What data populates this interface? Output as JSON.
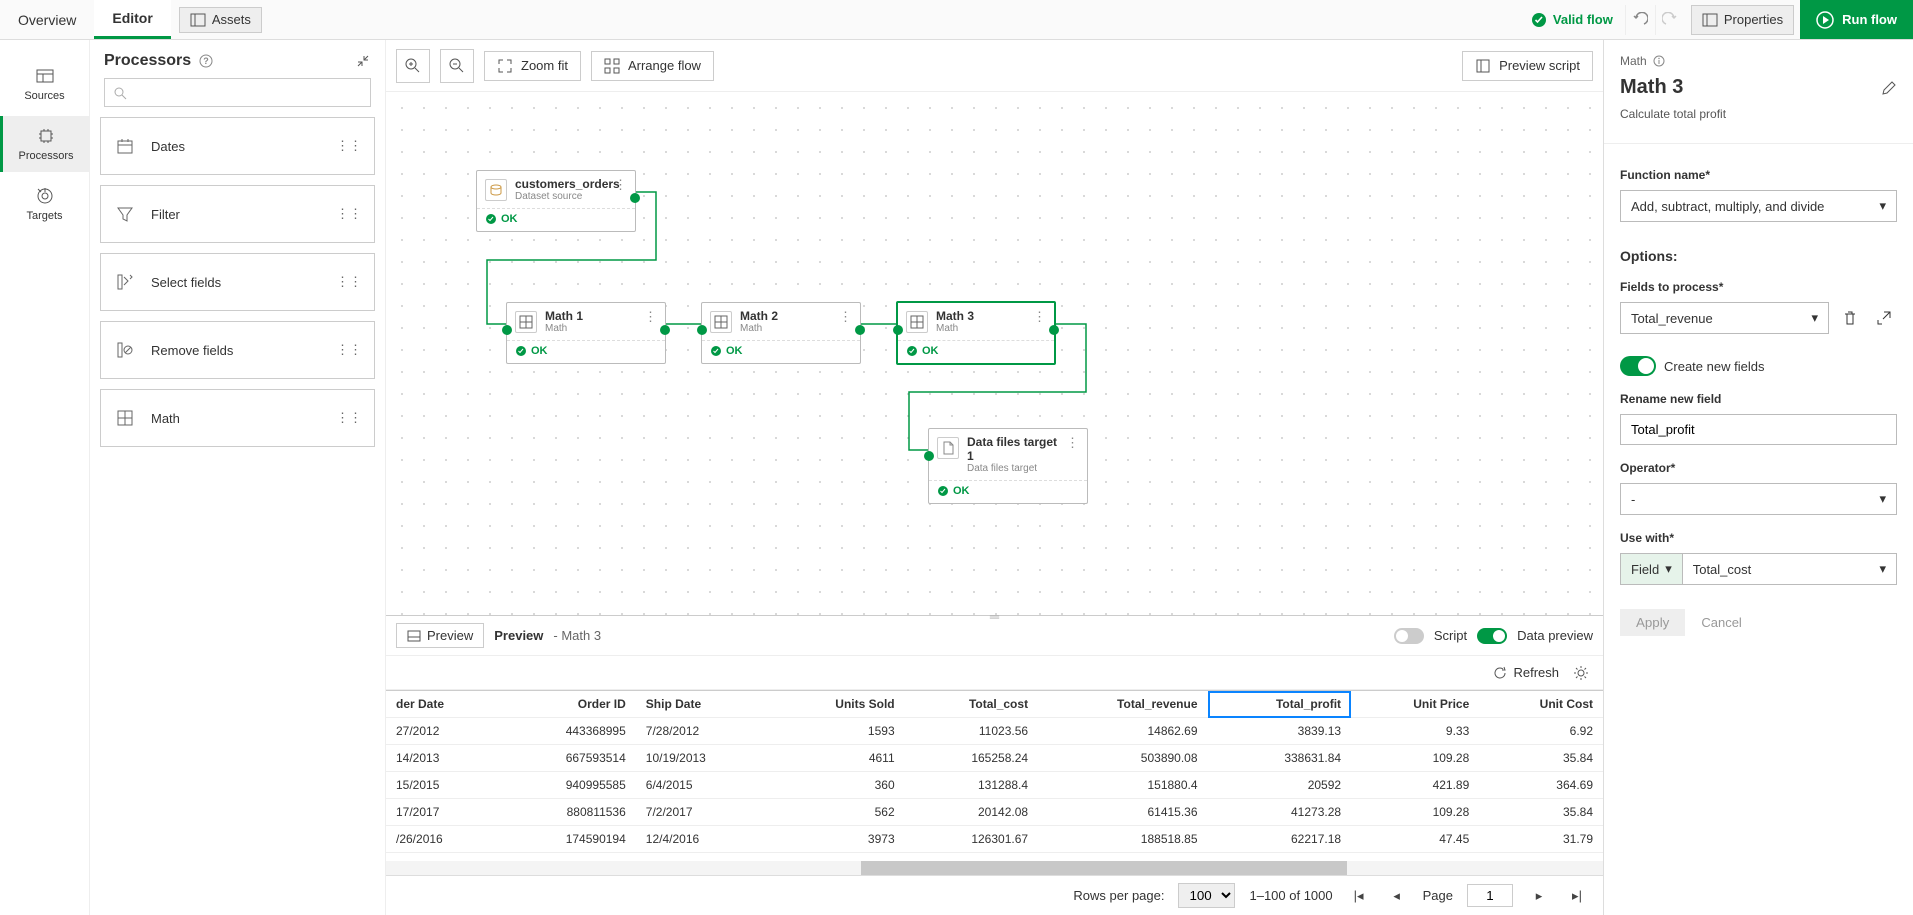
{
  "topbar": {
    "tab_overview": "Overview",
    "tab_editor": "Editor",
    "assets": "Assets",
    "valid_flow": "Valid flow",
    "properties": "Properties",
    "run_flow": "Run flow"
  },
  "leftnav": {
    "sources": "Sources",
    "processors": "Processors",
    "targets": "Targets"
  },
  "procpanel": {
    "title": "Processors",
    "items": [
      {
        "label": "Dates"
      },
      {
        "label": "Filter"
      },
      {
        "label": "Select fields"
      },
      {
        "label": "Remove fields"
      },
      {
        "label": "Math"
      }
    ]
  },
  "canvas_toolbar": {
    "zoom_fit": "Zoom fit",
    "arrange_flow": "Arrange flow",
    "preview_script": "Preview script"
  },
  "nodes": {
    "n1": {
      "title": "customers_orders",
      "sub": "Dataset source",
      "status": "OK"
    },
    "n2": {
      "title": "Math 1",
      "sub": "Math",
      "status": "OK"
    },
    "n3": {
      "title": "Math 2",
      "sub": "Math",
      "status": "OK"
    },
    "n4": {
      "title": "Math 3",
      "sub": "Math",
      "status": "OK"
    },
    "n5": {
      "title": "Data files target 1",
      "sub": "Data files target",
      "status": "OK"
    }
  },
  "preview": {
    "btn": "Preview",
    "label": "Preview",
    "context": "- Math 3",
    "script": "Script",
    "data_preview": "Data preview",
    "refresh": "Refresh",
    "columns": [
      "der Date",
      "Order ID",
      "Ship Date",
      "Units Sold",
      "Total_cost",
      "Total_revenue",
      "Total_profit",
      "Unit Price",
      "Unit Cost"
    ],
    "highlight_col": "Total_profit",
    "rows": [
      [
        "27/2012",
        "443368995",
        "7/28/2012",
        "1593",
        "11023.56",
        "14862.69",
        "3839.13",
        "9.33",
        "6.92"
      ],
      [
        "14/2013",
        "667593514",
        "10/19/2013",
        "4611",
        "165258.24",
        "503890.08",
        "338631.84",
        "109.28",
        "35.84"
      ],
      [
        "15/2015",
        "940995585",
        "6/4/2015",
        "360",
        "131288.4",
        "151880.4",
        "20592",
        "421.89",
        "364.69"
      ],
      [
        "17/2017",
        "880811536",
        "7/2/2017",
        "562",
        "20142.08",
        "61415.36",
        "41273.28",
        "109.28",
        "35.84"
      ],
      [
        "/26/2016",
        "174590194",
        "12/4/2016",
        "3973",
        "126301.67",
        "188518.85",
        "62217.18",
        "47.45",
        "31.79"
      ]
    ],
    "rows_per_page_label": "Rows per page:",
    "rows_per_page": "100",
    "range": "1–100 of 1000",
    "page_label": "Page",
    "page": "1"
  },
  "rightpanel": {
    "crumb": "Math",
    "title": "Math 3",
    "desc": "Calculate total profit",
    "function_name_label": "Function name*",
    "function_name": "Add, subtract, multiply, and divide",
    "options_label": "Options:",
    "fields_label": "Fields to process*",
    "fields_value": "Total_revenue",
    "create_new_label": "Create new fields",
    "rename_label": "Rename new field",
    "rename_value": "Total_profit",
    "operator_label": "Operator*",
    "operator_value": "-",
    "use_with_label": "Use with*",
    "use_with_kind": "Field",
    "use_with_value": "Total_cost",
    "apply": "Apply",
    "cancel": "Cancel"
  }
}
